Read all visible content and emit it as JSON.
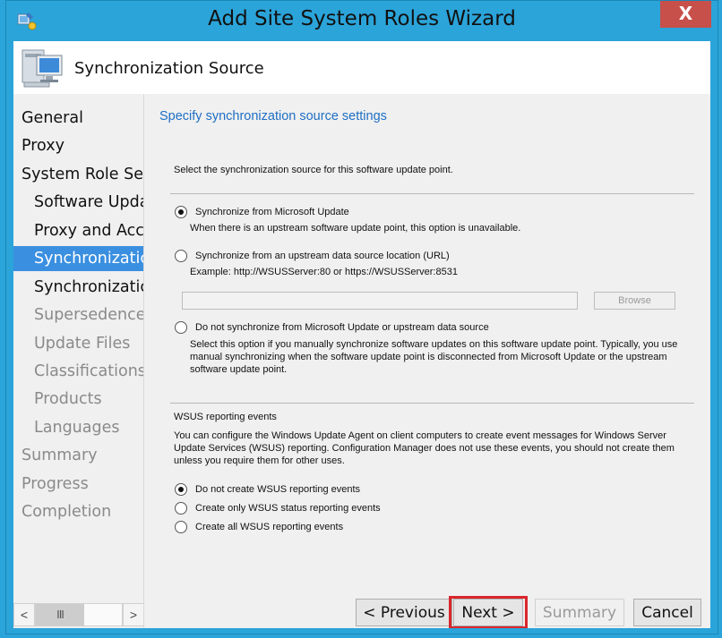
{
  "window": {
    "title": "Add Site System Roles Wizard",
    "close_label": "X"
  },
  "header": {
    "title": "Synchronization Source"
  },
  "nav": {
    "items": [
      {
        "label": "General",
        "state": "normal"
      },
      {
        "label": "Proxy",
        "state": "normal"
      },
      {
        "label": "System Role Sel",
        "state": "normal"
      },
      {
        "label": "Software Upda",
        "state": "normal"
      },
      {
        "label": "Proxy and Acc",
        "state": "normal"
      },
      {
        "label": "Synchronizatic",
        "state": "selected"
      },
      {
        "label": "Synchronizatic",
        "state": "normal"
      },
      {
        "label": "Supersedence",
        "state": "dim"
      },
      {
        "label": "Update Files",
        "state": "dim"
      },
      {
        "label": "Classifications",
        "state": "dim"
      },
      {
        "label": "Products",
        "state": "dim"
      },
      {
        "label": "Languages",
        "state": "dim"
      },
      {
        "label": "Summary",
        "state": "dim"
      },
      {
        "label": "Progress",
        "state": "dim"
      },
      {
        "label": "Completion",
        "state": "dim"
      }
    ],
    "scroll_left": "<",
    "scroll_right": ">",
    "scroll_thumb": "III"
  },
  "content": {
    "section_title": "Specify synchronization source settings",
    "intro": "Select the synchronization source for this software update point.",
    "source_options": [
      {
        "label": "Synchronize from Microsoft Update",
        "checked": true,
        "note": "When there is an upstream software update point, this option is unavailable."
      },
      {
        "label": "Synchronize from an upstream data source location (URL)",
        "checked": false,
        "note": "Example: http://WSUSServer:80 or https://WSUSServer:8531"
      },
      {
        "label": "Do not synchronize from Microsoft Update or upstream data source",
        "checked": false,
        "note": "Select this option if you manually synchronize software updates on this software update point. Typically, you use manual synchronizing when the software update point is disconnected from Microsoft Update or the upstream software update point."
      }
    ],
    "url_value": "",
    "browse_label": "Browse",
    "wsus_heading": "WSUS reporting events",
    "wsus_description": "You can configure the Windows Update Agent on client computers to create event messages for Windows Server Update Services (WSUS) reporting. Configuration Manager does not use these events, you should not create them unless you require them for other uses.",
    "wsus_options": [
      {
        "label": "Do not create WSUS reporting events",
        "checked": true
      },
      {
        "label": "Create only WSUS status reporting events",
        "checked": false
      },
      {
        "label": "Create all WSUS reporting events",
        "checked": false
      }
    ]
  },
  "buttons": {
    "previous": "< Previous",
    "next": "Next >",
    "summary": "Summary",
    "cancel": "Cancel"
  },
  "colors": {
    "frame": "#2ba4d9",
    "accent_link": "#1e6fc4",
    "selected_nav": "#3a8fe0",
    "highlight": "#d9262b",
    "close_button": "#c7504a"
  }
}
